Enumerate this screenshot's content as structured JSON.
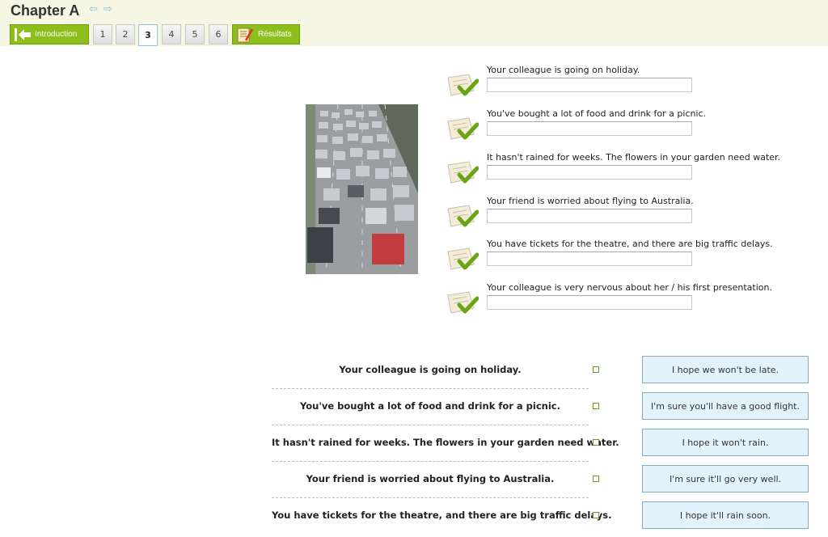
{
  "header": {
    "chapter_title": "Chapter A",
    "intro_label": "Introduction",
    "results_label": "Résultats",
    "pages": [
      "1",
      "2",
      "3",
      "4",
      "5",
      "6"
    ],
    "active_page": "3"
  },
  "prompts": [
    {
      "question": "Your colleague is going on holiday.",
      "answer": ""
    },
    {
      "question": "You've bought a lot of food and drink for a picnic.",
      "answer": ""
    },
    {
      "question": "It hasn't rained for weeks. The flowers in your garden need water.",
      "answer": ""
    },
    {
      "question": "Your friend is worried about flying to Australia.",
      "answer": ""
    },
    {
      "question": "You have tickets for the theatre, and there are big traffic delays.",
      "answer": ""
    },
    {
      "question": "Your colleague is very nervous about her / his first presentation.",
      "answer": ""
    }
  ],
  "matching": {
    "left": [
      "Your colleague is going on holiday.",
      "You've bought a lot of food and drink for a picnic.",
      "It hasn't rained for weeks. The flowers in your garden need water.",
      "Your friend is worried about flying to Australia.",
      "You have tickets for the theatre, and there are big traffic delays."
    ],
    "right": [
      "I hope we won't be late.",
      "I'm sure you'll have a good flight.",
      "I hope it won't rain.",
      "I'm sure it'll go very well.",
      "I hope it'll rain soon."
    ]
  }
}
